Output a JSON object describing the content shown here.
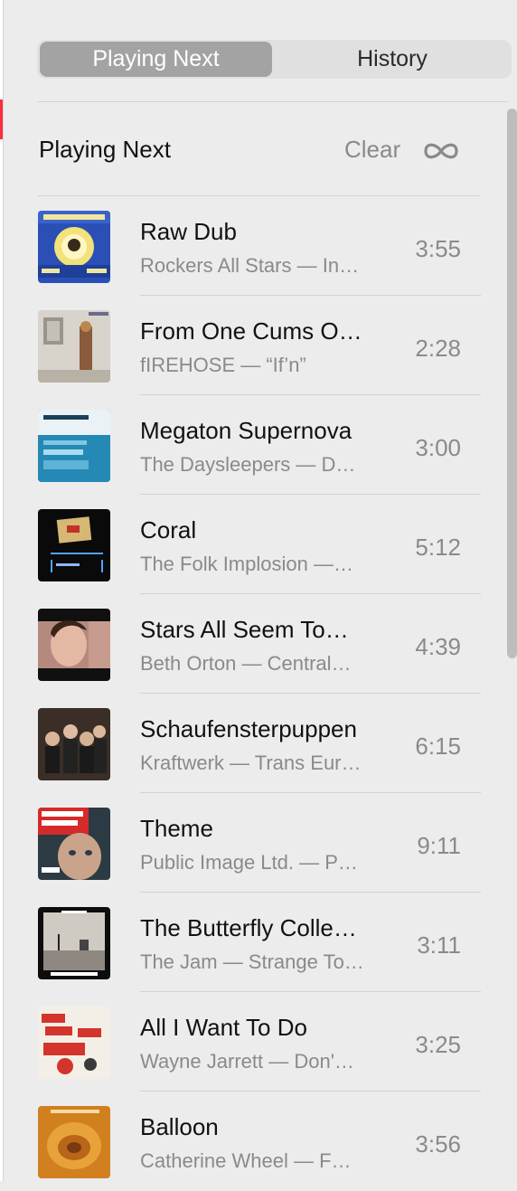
{
  "tabs": {
    "playing_next": "Playing Next",
    "history": "History"
  },
  "header": {
    "title": "Playing Next",
    "clear": "Clear",
    "repeat_icon": "infinity-icon"
  },
  "queue": [
    {
      "title": "Raw Dub",
      "subtitle": "Rockers All Stars — In…",
      "duration": "3:55"
    },
    {
      "title": "From One Cums O…",
      "subtitle": "fIREHOSE — “If’n”",
      "duration": "2:28"
    },
    {
      "title": "Megaton Supernova",
      "subtitle": "The Daysleepers — D…",
      "duration": "3:00"
    },
    {
      "title": "Coral",
      "subtitle": "The Folk Implosion —…",
      "duration": "5:12"
    },
    {
      "title": "Stars All Seem To…",
      "subtitle": "Beth Orton — Central…",
      "duration": "4:39"
    },
    {
      "title": "Schaufensterpuppen",
      "subtitle": "Kraftwerk — Trans Eur…",
      "duration": "6:15"
    },
    {
      "title": "Theme",
      "subtitle": "Public Image Ltd. — P…",
      "duration": "9:11"
    },
    {
      "title": "The Butterfly Colle…",
      "subtitle": "The Jam — Strange To…",
      "duration": "3:11"
    },
    {
      "title": "All I Want To Do",
      "subtitle": "Wayne Jarrett — Don'…",
      "duration": "3:25"
    },
    {
      "title": "Balloon",
      "subtitle": "Catherine Wheel — F…",
      "duration": "3:56"
    }
  ],
  "colors": {
    "active_tab": "#a3a3a3",
    "background": "#ececec",
    "accent_red": "#ff2d3d"
  }
}
